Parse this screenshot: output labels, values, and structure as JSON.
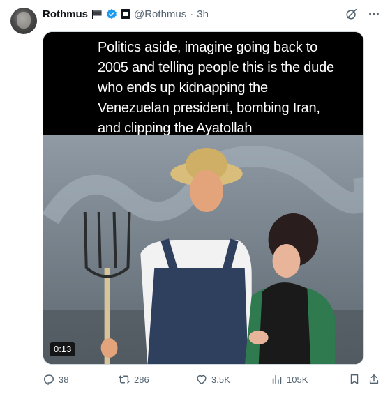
{
  "author": {
    "display_name": "Rothmus",
    "handle": "@Rothmus",
    "separator": "·",
    "time_ago": "3h",
    "icons": [
      "flag-icon",
      "verified-icon",
      "affiliate-badge-icon"
    ]
  },
  "top_actions": [
    "grok-icon",
    "more-icon"
  ],
  "media": {
    "caption": "Politics aside, imagine going back to 2005 and telling people this is the dude who ends up kidnapping the Venezuelan president, bombing Iran, and clipping the Ayatollah",
    "duration": "0:13"
  },
  "actions": {
    "replies": "38",
    "reposts": "286",
    "likes": "3.5K",
    "views": "105K"
  },
  "colors": {
    "text": "#0f1419",
    "secondary": "#536471",
    "verified": "#1d9bf0",
    "border": "#cfd9de"
  }
}
